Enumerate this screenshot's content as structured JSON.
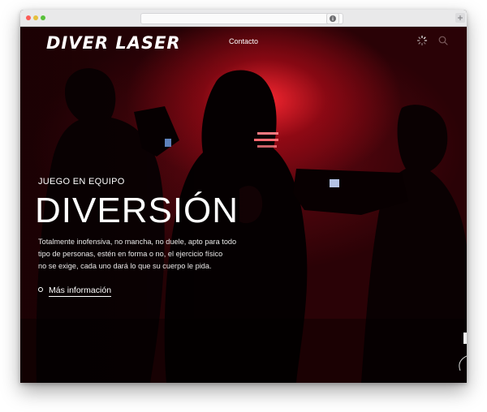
{
  "brand": {
    "logo_text": "DIVER LASER"
  },
  "nav": {
    "items": [
      {
        "label": "Contacto"
      }
    ]
  },
  "hero": {
    "eyebrow": "JUEGO EN EQUIPO",
    "headline": "DIVERSIÓN",
    "body_lines": [
      "Totalmente inofensiva, no mancha, no duele, apto para todo",
      "tipo de personas, estén en forma o no, el ejercicio físico",
      "no se exige, cada uno dará lo que su cuerpo le pida."
    ],
    "cta_label": "Más información"
  },
  "icons": {
    "loader": "loader-icon",
    "search": "search-icon",
    "reload": "reload-icon",
    "browser_action": "info-icon",
    "new_tab": "plus-icon"
  },
  "colors": {
    "hero_red": "#8a0a16",
    "hero_glow": "#ff2832",
    "text": "#ffffff",
    "browser_chrome": "#e9e9ea"
  }
}
